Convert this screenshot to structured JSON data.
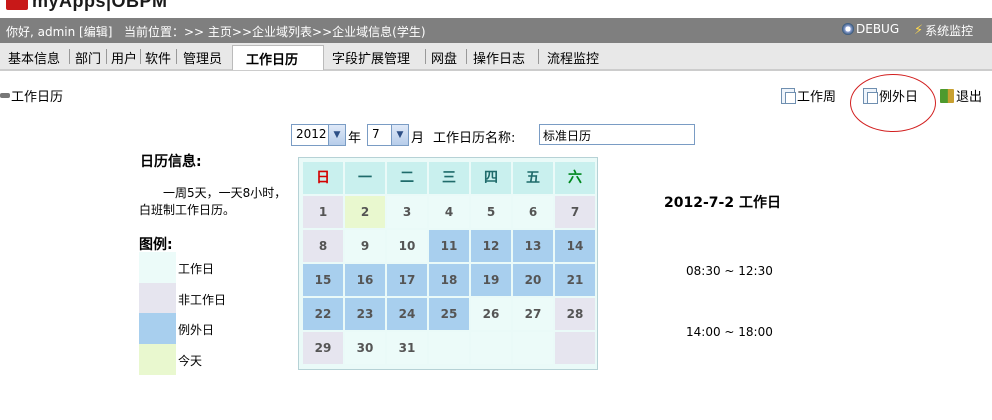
{
  "header": {
    "logo_text": "myApps|OBPM",
    "greeting": "你好, admin [编辑]",
    "location": "当前位置：>> 主页>>企业域列表>>企业域信息(学生)",
    "debug_label": "DEBUG",
    "monitor_label": "系统监控"
  },
  "tabs": [
    {
      "label": "基本信息"
    },
    {
      "label": "部门"
    },
    {
      "label": "用户"
    },
    {
      "label": "软件"
    },
    {
      "label": "管理员"
    },
    {
      "label": "工作日历"
    },
    {
      "label": "字段扩展管理"
    },
    {
      "label": "网盘"
    },
    {
      "label": "操作日志"
    },
    {
      "label": "流程监控"
    }
  ],
  "page": {
    "title": "工作日历",
    "actions": {
      "work_week": "工作周",
      "exception_day": "例外日",
      "exit": "退出"
    }
  },
  "selector": {
    "year": "2012",
    "year_unit": "年",
    "month": "7",
    "month_unit": "月",
    "name_label": "工作日历名称:",
    "name_value": "标准日历"
  },
  "info": {
    "title": "日历信息:",
    "description": "一周5天，一天8小时，白班制工作日历。",
    "legend_title": "图例:",
    "legend": [
      {
        "label": "工作日",
        "color": "#ecfbf9"
      },
      {
        "label": "非工作日",
        "color": "#e6e5ef"
      },
      {
        "label": "例外日",
        "color": "#a8cfee"
      },
      {
        "label": "今天",
        "color": "#e9f8cf"
      }
    ]
  },
  "calendar": {
    "weekdays": [
      "日",
      "一",
      "二",
      "三",
      "四",
      "五",
      "六"
    ],
    "weekday_colors": [
      "#d40000",
      "#1f6b6b",
      "#1f6b6b",
      "#1f6b6b",
      "#1f6b6b",
      "#1f6b6b",
      "#00881e"
    ],
    "days": [
      {
        "d": "1",
        "t": "non"
      },
      {
        "d": "2",
        "t": "today"
      },
      {
        "d": "3",
        "t": "work"
      },
      {
        "d": "4",
        "t": "work"
      },
      {
        "d": "5",
        "t": "work"
      },
      {
        "d": "6",
        "t": "work"
      },
      {
        "d": "7",
        "t": "non"
      },
      {
        "d": "8",
        "t": "non"
      },
      {
        "d": "9",
        "t": "work"
      },
      {
        "d": "10",
        "t": "work"
      },
      {
        "d": "11",
        "t": "exc"
      },
      {
        "d": "12",
        "t": "exc"
      },
      {
        "d": "13",
        "t": "exc"
      },
      {
        "d": "14",
        "t": "exc"
      },
      {
        "d": "15",
        "t": "exc"
      },
      {
        "d": "16",
        "t": "exc"
      },
      {
        "d": "17",
        "t": "exc"
      },
      {
        "d": "18",
        "t": "exc"
      },
      {
        "d": "19",
        "t": "exc"
      },
      {
        "d": "20",
        "t": "exc"
      },
      {
        "d": "21",
        "t": "exc"
      },
      {
        "d": "22",
        "t": "exc"
      },
      {
        "d": "23",
        "t": "exc"
      },
      {
        "d": "24",
        "t": "exc"
      },
      {
        "d": "25",
        "t": "exc"
      },
      {
        "d": "26",
        "t": "work"
      },
      {
        "d": "27",
        "t": "work"
      },
      {
        "d": "28",
        "t": "non"
      },
      {
        "d": "29",
        "t": "non"
      },
      {
        "d": "30",
        "t": "work"
      },
      {
        "d": "31",
        "t": "work"
      },
      {
        "d": "",
        "t": "work"
      },
      {
        "d": "",
        "t": "work"
      },
      {
        "d": "",
        "t": "work"
      },
      {
        "d": "",
        "t": "non"
      }
    ],
    "type_colors": {
      "work": "#ecfbf9",
      "non": "#e6e5ef",
      "exc": "#a8cfee",
      "today": "#e9f8cf"
    }
  },
  "detail": {
    "date_title": "2012-7-2 工作日",
    "times": [
      "08:30 ~ 12:30",
      "14:00 ~ 18:00"
    ]
  }
}
